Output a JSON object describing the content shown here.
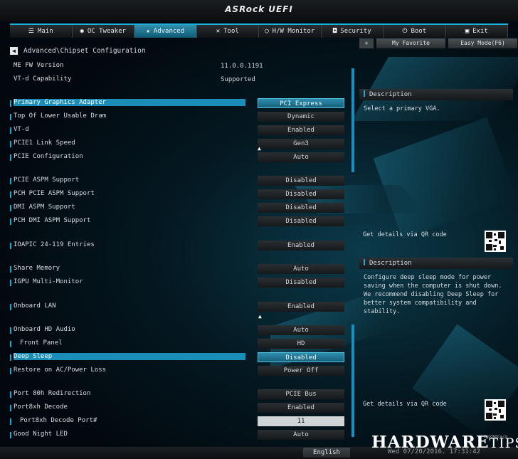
{
  "brand": "ASRock UEFI",
  "tabs": [
    {
      "label": "Main",
      "icon": "list-icon"
    },
    {
      "label": "OC Tweaker",
      "icon": "robot-icon"
    },
    {
      "label": "Advanced",
      "icon": "star-icon"
    },
    {
      "label": "Tool",
      "icon": "tools-icon"
    },
    {
      "label": "H/W Monitor",
      "icon": "monitor-icon"
    },
    {
      "label": "Security",
      "icon": "shield-icon"
    },
    {
      "label": "Boot",
      "icon": "power-icon"
    },
    {
      "label": "Exit",
      "icon": "exit-icon"
    }
  ],
  "active_tab": "Advanced",
  "favorite": {
    "my_favorite": "My Favorite",
    "easy_mode": "Easy Mode(F6)"
  },
  "breadcrumb": "Advanced\\Chipset Configuration",
  "info": [
    {
      "label": "ME FW Version",
      "value": "11.0.0.1191"
    },
    {
      "label": "VT-d Capability",
      "value": "Supported"
    }
  ],
  "settings": [
    {
      "label": "Primary Graphics Adapter",
      "value": "PCI Express"
    },
    {
      "label": "Top Of Lower Usable Dram",
      "value": "Dynamic"
    },
    {
      "label": "VT-d",
      "value": "Enabled"
    },
    {
      "label": "PCIE1 Link Speed",
      "value": "Gen3"
    },
    {
      "label": "PCIE Configuration",
      "value": "Auto"
    },
    {
      "label": "PCIE ASPM Support",
      "value": "Disabled"
    },
    {
      "label": "PCH PCIE ASPM Support",
      "value": "Disabled"
    },
    {
      "label": "DMI ASPM Support",
      "value": "Disabled"
    },
    {
      "label": "PCH DMI ASPM Support",
      "value": "Disabled"
    },
    {
      "label": "IOAPIC 24-119 Entries",
      "value": "Enabled"
    },
    {
      "label": "Share Memory",
      "value": "Auto"
    },
    {
      "label": "IGPU Multi-Monitor",
      "value": "Disabled"
    },
    {
      "label": "Onboard LAN",
      "value": "Enabled"
    },
    {
      "label": "Onboard HD Audio",
      "value": "Auto"
    },
    {
      "label": "Front Panel",
      "value": "HD"
    },
    {
      "label": "Deep Sleep",
      "value": "Disabled"
    },
    {
      "label": "Restore on AC/Power Loss",
      "value": "Power Off"
    },
    {
      "label": "Port 80h Redirection",
      "value": "PCIE Bus"
    },
    {
      "label": "Port8xh Decode",
      "value": "Enabled"
    },
    {
      "label": "Port8xh Decode Port#",
      "value": "11"
    },
    {
      "label": "Good Night LED",
      "value": "Auto"
    }
  ],
  "desc1": {
    "title": "Description",
    "body": "Select a primary VGA.",
    "qr": "Get details via QR code"
  },
  "desc2": {
    "title": "Description",
    "body": "Configure deep sleep mode for power saving when the computer is shut down. We recommend disabling Deep Sleep for better system compatibility and stability.",
    "qr": "Get details via QR code"
  },
  "footer": {
    "language": "English",
    "datetime": "Wed 07/20/2016. 17:31:42"
  },
  "watermark": {
    "main": "HARDWARE",
    "tips": "TIPS",
    "tag": "BY GONDO & CO"
  },
  "colors": {
    "accent": "#1aa9d3",
    "selection": "#1a8eb8"
  }
}
